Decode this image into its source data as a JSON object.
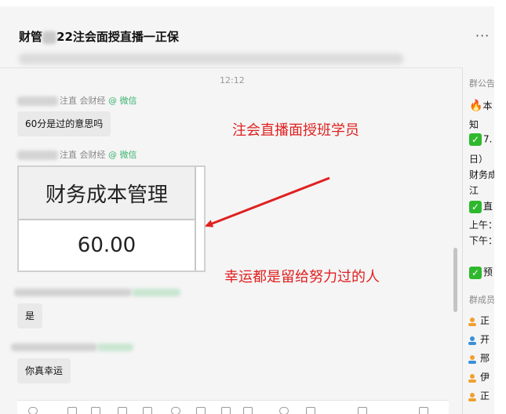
{
  "header": {
    "title_prefix": "财管",
    "title_suffix": "22注会面授直播一正保",
    "more_label": "···"
  },
  "chat": {
    "timestamp": "12:12",
    "messages": [
      {
        "sender_suffix": "注直 会财经",
        "source": "@ 微信",
        "text": "60分是过的意思吗"
      },
      {
        "sender_suffix": "注直 会财经",
        "source": "@ 微信",
        "image_header": "财务成本管理",
        "image_value": "60.00"
      },
      {
        "text": "是"
      },
      {
        "text": "你真幸运"
      }
    ],
    "annotations": {
      "top": "注会直播面授班学员",
      "bottom": "幸运都是留给努力过的人"
    }
  },
  "sidebar": {
    "announcement_label": "群公告",
    "announcement_lines": [
      "本",
      "知",
      "7.",
      "日）",
      "财务成",
      "江",
      "直",
      "上午：",
      "下午：",
      "预"
    ],
    "members_label": "群成员",
    "members": [
      "正",
      "开",
      "邢",
      "伊",
      "正"
    ]
  },
  "colors": {
    "annotation": "#e02020",
    "check": "#2eb82e",
    "wechat": "#3cb371"
  }
}
